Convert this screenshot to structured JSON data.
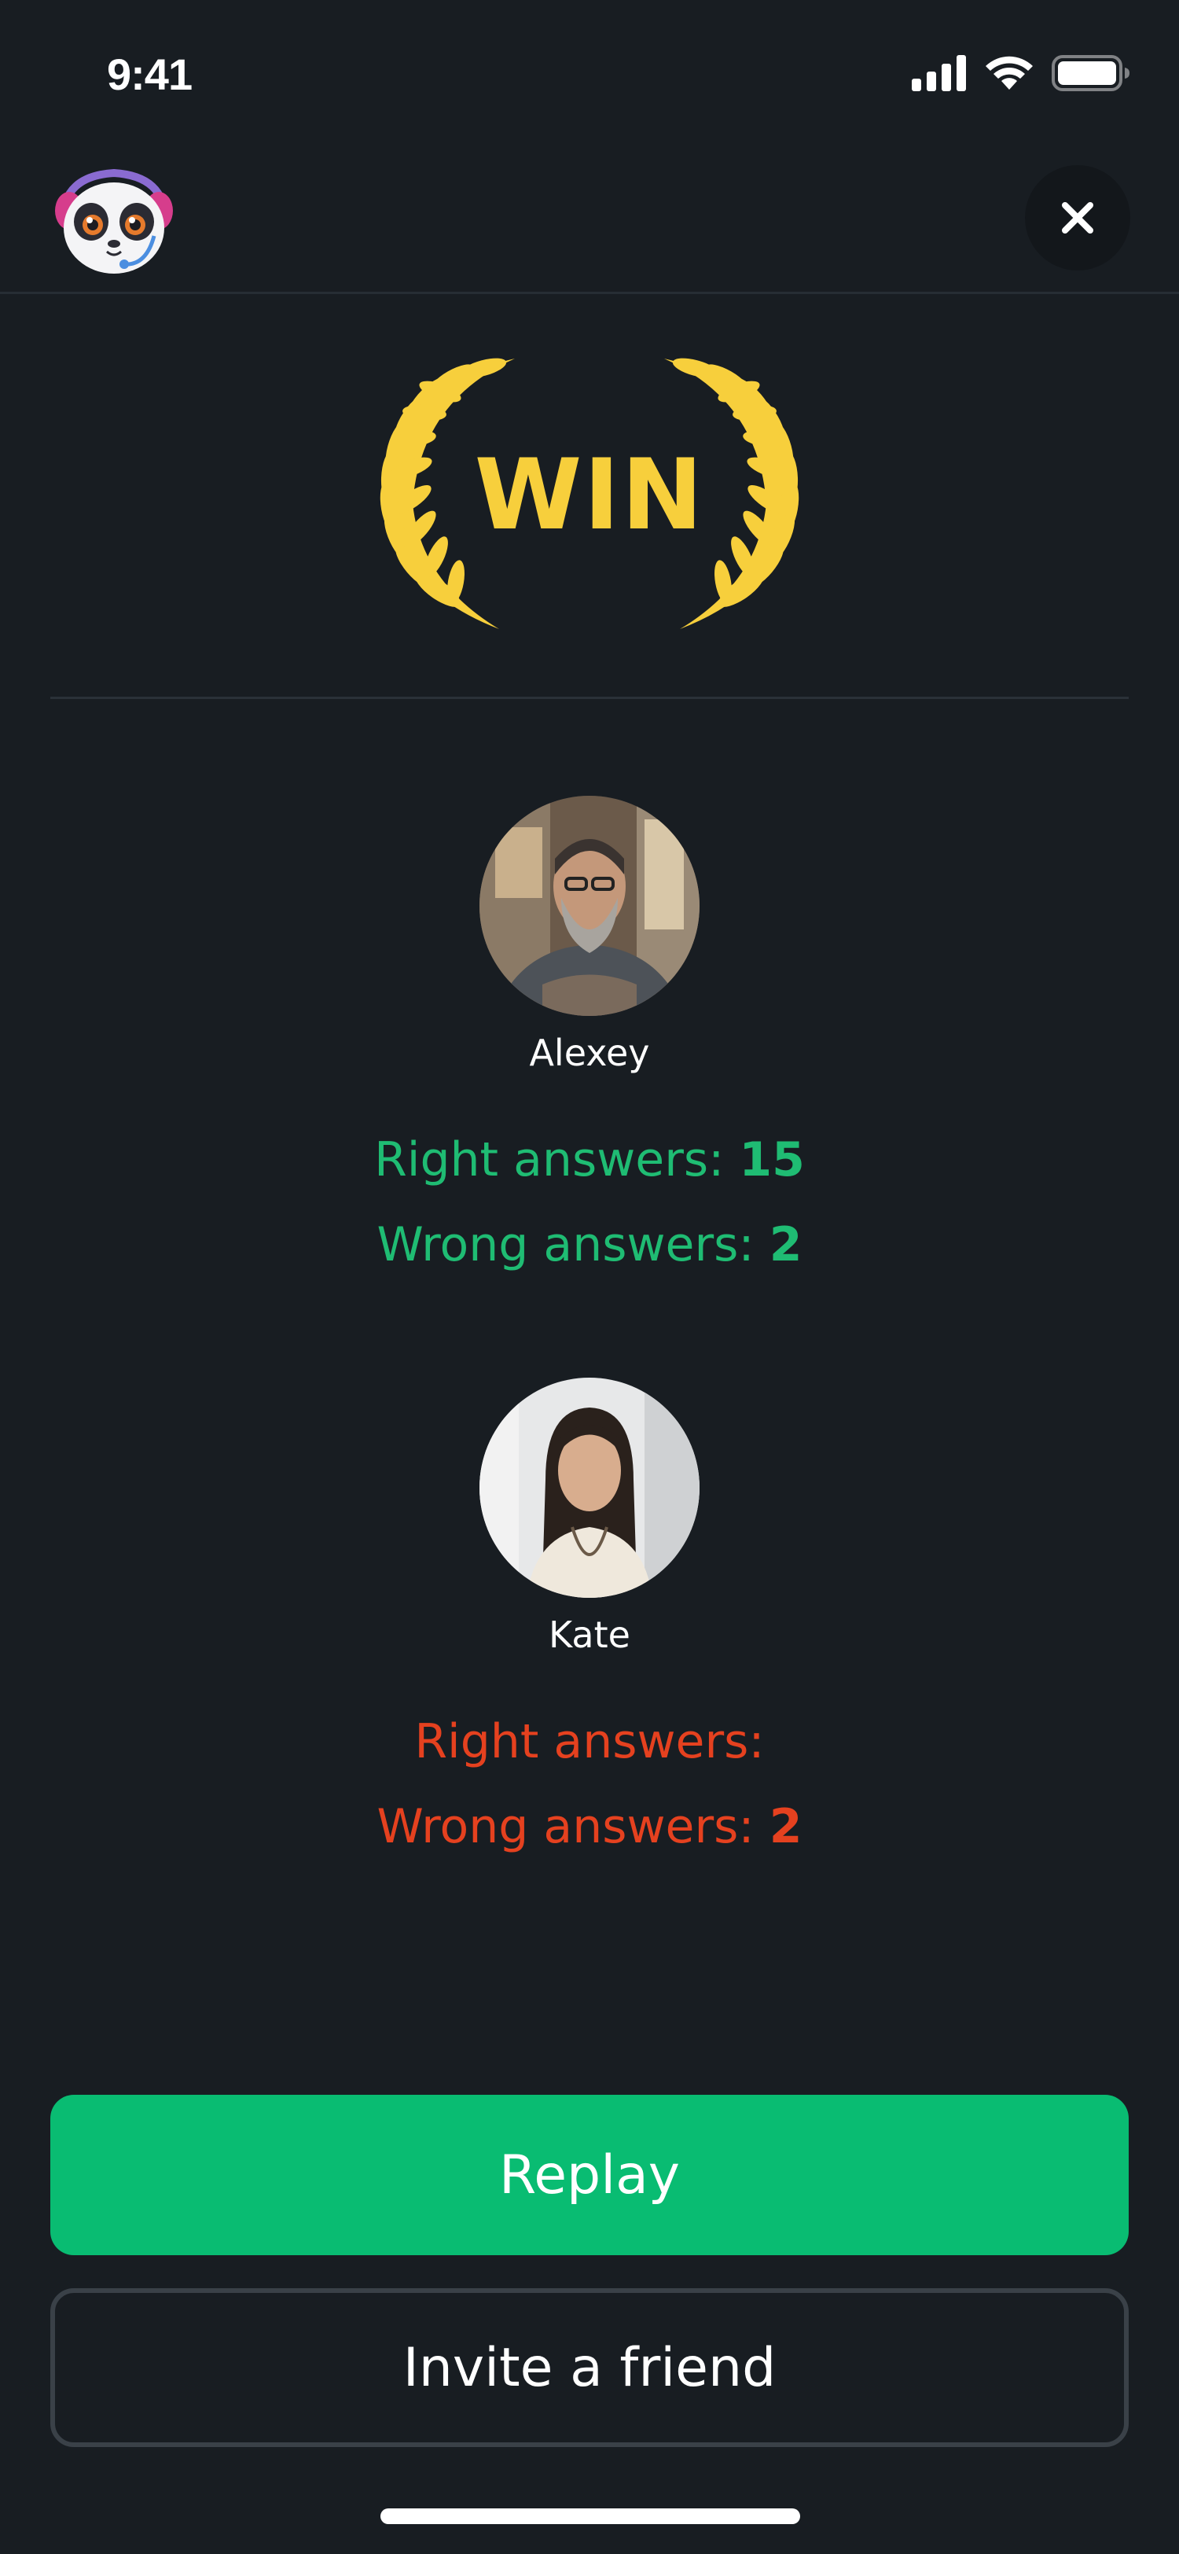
{
  "status_bar": {
    "time": "9:41",
    "icons": [
      "signal-icon",
      "wifi-icon",
      "battery-icon"
    ]
  },
  "header": {
    "mascot_icon": "panda-mascot-icon",
    "close_icon": "close-icon"
  },
  "result": {
    "label": "WIN",
    "color": "#f7cf3c"
  },
  "players": [
    {
      "name": "Alexey",
      "right_label": "Right answers:",
      "right_value": "15",
      "wrong_label": "Wrong answers:",
      "wrong_value": "2",
      "color": "#1fbc73"
    },
    {
      "name": "Kate",
      "right_label": "Right answers:",
      "right_value": "",
      "wrong_label": "Wrong answers:",
      "wrong_value": "2",
      "color": "#e5411f"
    }
  ],
  "actions": {
    "replay_label": "Replay",
    "invite_label": "Invite a friend",
    "replay_color": "#09bc72"
  }
}
